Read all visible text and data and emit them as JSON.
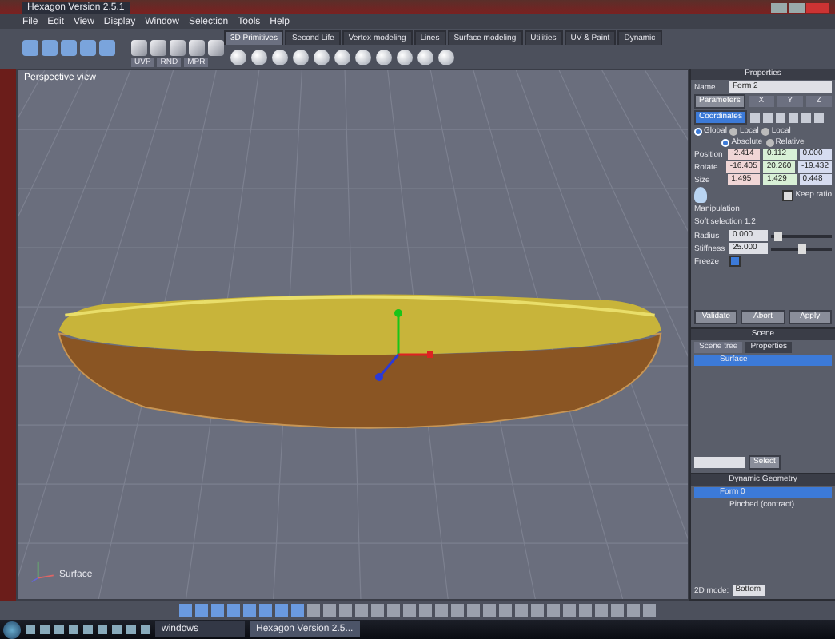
{
  "window": {
    "title": "Hexagon Version 2.5.1"
  },
  "menu": [
    "File",
    "Edit",
    "View",
    "Display",
    "Window",
    "Selection",
    "Tools",
    "Help"
  ],
  "tool_tabs": [
    {
      "label": "3D Primitives",
      "selected": true
    },
    {
      "label": "Second Life",
      "selected": false
    },
    {
      "label": "Vertex modeling",
      "selected": false
    },
    {
      "label": "Lines",
      "selected": false
    },
    {
      "label": "Surface modeling",
      "selected": false
    },
    {
      "label": "Utilities",
      "selected": false
    },
    {
      "label": "UV & Paint",
      "selected": false
    },
    {
      "label": "Dynamic",
      "selected": false
    }
  ],
  "tool_fields": [
    "UVP",
    "RND",
    "MPR"
  ],
  "viewport": {
    "label": "Perspective view",
    "object_label": "Surface"
  },
  "properties": {
    "title": "Properties",
    "name_label": "Name",
    "name_value": "Form 2",
    "parameters_button": "Parameters",
    "axes": [
      "X",
      "Y",
      "Z"
    ],
    "coordinates_button": "Coordinates",
    "frames": [
      {
        "label": "Global",
        "selected": true
      },
      {
        "label": "Local",
        "selected": false
      },
      {
        "label": "Local",
        "selected": false
      }
    ],
    "modes": [
      {
        "label": "Absolute",
        "selected": true
      },
      {
        "label": "Relative",
        "selected": false
      }
    ],
    "rows": [
      {
        "label": "Position",
        "values": [
          "-2.414",
          "0.112",
          "0.000"
        ]
      },
      {
        "label": "Rotate",
        "values": [
          "-16.405",
          "20.260",
          "-19.432"
        ]
      },
      {
        "label": "Size",
        "values": [
          "1.495",
          "1.429",
          "0.448"
        ]
      }
    ],
    "keep_ratio": {
      "label": "Keep ratio",
      "checked": false
    },
    "manipulation": "Manipulation",
    "soft_selection": "Soft selection 1.2",
    "sliders": [
      {
        "label": "Radius",
        "value": "0.000",
        "level": 0.1
      },
      {
        "label": "Stiffness",
        "value": "25.000",
        "level": 0.5
      }
    ],
    "freeze": {
      "label": "Freeze",
      "checked": true
    },
    "buttons": [
      "Validate",
      "Abort",
      "Apply"
    ]
  },
  "scene": {
    "title": "Scene",
    "tabs": [
      {
        "label": "Scene tree",
        "selected": true
      },
      {
        "label": "Properties",
        "selected": false
      }
    ],
    "items": [
      {
        "label": "Surface",
        "selected": true
      }
    ],
    "select_button": "Select"
  },
  "dynamic": {
    "title": "Dynamic Geometry",
    "items": [
      {
        "label": "Form 0",
        "selected": true,
        "children": [
          {
            "label": "Pinched (contract)",
            "selected": false
          }
        ]
      }
    ]
  },
  "status": {
    "mode_label": "2D mode:",
    "mode_value": "Bottom"
  },
  "taskbar": [
    {
      "label": "windows",
      "selected": false
    },
    {
      "label": "Hexagon Version 2.5...",
      "selected": true
    }
  ]
}
